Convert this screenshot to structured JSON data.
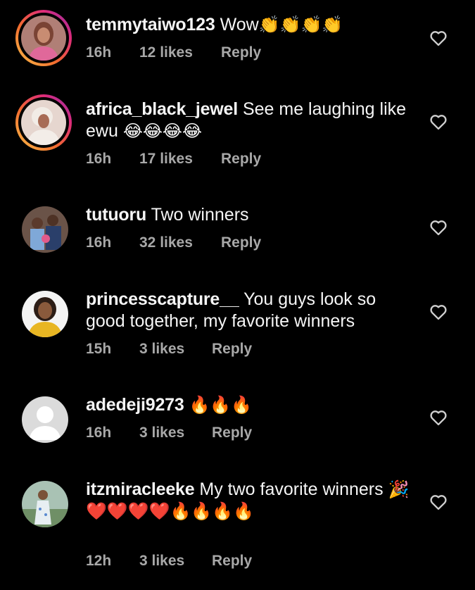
{
  "comments": [
    {
      "username": "temmytaiwo123",
      "text": "Wow",
      "emoji": "👏👏👏👏",
      "time": "16h",
      "likes": "12 likes",
      "reply": "Reply"
    },
    {
      "username": "africa_black_jewel",
      "text": "See me laughing like ewu",
      "emoji": "😂😂😂😂",
      "time": "16h",
      "likes": "17 likes",
      "reply": "Reply"
    },
    {
      "username": "tutuoru",
      "text": "Two winners",
      "time": "16h",
      "likes": "32 likes",
      "reply": "Reply"
    },
    {
      "username": "princesscapture__",
      "text": "You guys look so good together, my favorite winners",
      "time": "15h",
      "likes": "3 likes",
      "reply": "Reply"
    },
    {
      "username": "adedeji9273",
      "text": "",
      "emoji": "🔥🔥🔥",
      "time": "16h",
      "likes": "3 likes",
      "reply": "Reply"
    },
    {
      "username": "itzmiracleeke",
      "text": "My two favorite winners",
      "emoji": "🎉",
      "emoji_line2": "❤️❤️❤️❤️🔥🔥🔥🔥",
      "time": "12h",
      "likes": "3 likes",
      "reply": "Reply"
    }
  ],
  "icons": {
    "like": "heart-outline-icon",
    "default_avatar": "default-user-avatar-icon"
  },
  "colors": {
    "background": "#000000",
    "text": "#f5f5f5",
    "meta": "#a8a8a8",
    "story_ring_start": "#f9c34a",
    "story_ring_end": "#8134af"
  }
}
